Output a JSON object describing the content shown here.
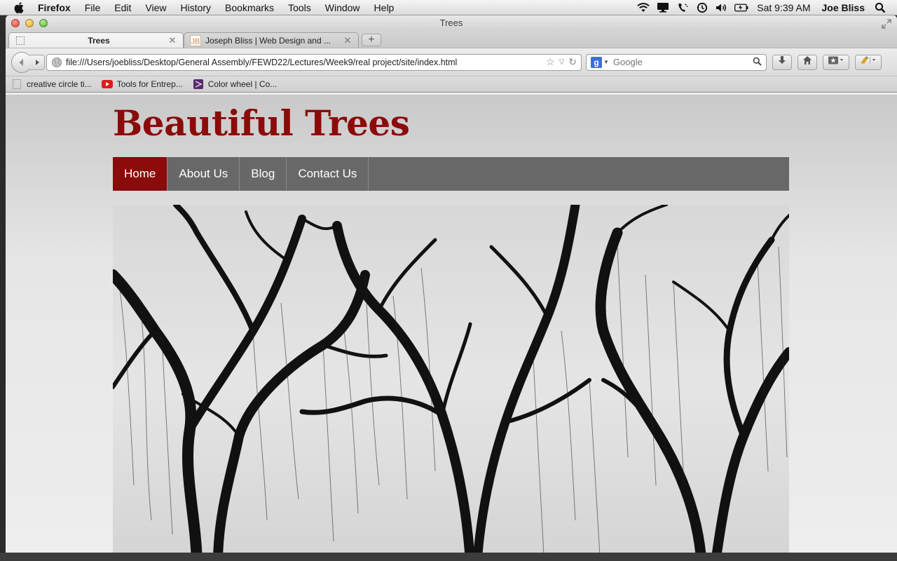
{
  "menubar": {
    "app_name": "Firefox",
    "items": [
      "File",
      "Edit",
      "View",
      "History",
      "Bookmarks",
      "Tools",
      "Window",
      "Help"
    ],
    "clock": "Sat 9:39 AM",
    "user": "Joe Bliss",
    "icons": [
      "wifi-icon",
      "display-icon",
      "phone-icon",
      "time-machine-icon",
      "volume-icon",
      "battery-icon",
      "spotlight-search-icon"
    ]
  },
  "window": {
    "title": "Trees"
  },
  "tabs": [
    {
      "title": "Trees",
      "active": true
    },
    {
      "title": "Joseph Bliss | Web Design and ...",
      "active": false
    }
  ],
  "navbar": {
    "url": "file:///Users/joebliss/Desktop/General Assembly/FEWD22/Lectures/Week9/real project/site/index.html",
    "search_placeholder": "Google"
  },
  "bookmarks": [
    {
      "label": "creative circle ti...",
      "icon": "page-icon"
    },
    {
      "label": "Tools for Entrep...",
      "icon": "youtube-icon"
    },
    {
      "label": "Color wheel | Co...",
      "icon": "kuler-icon"
    }
  ],
  "site": {
    "title": "Beautiful Trees",
    "nav": [
      "Home",
      "About Us",
      "Blog",
      "Contact Us"
    ],
    "active_nav": "Home",
    "accent_color": "#8b0a0a",
    "nav_color": "#686868"
  }
}
